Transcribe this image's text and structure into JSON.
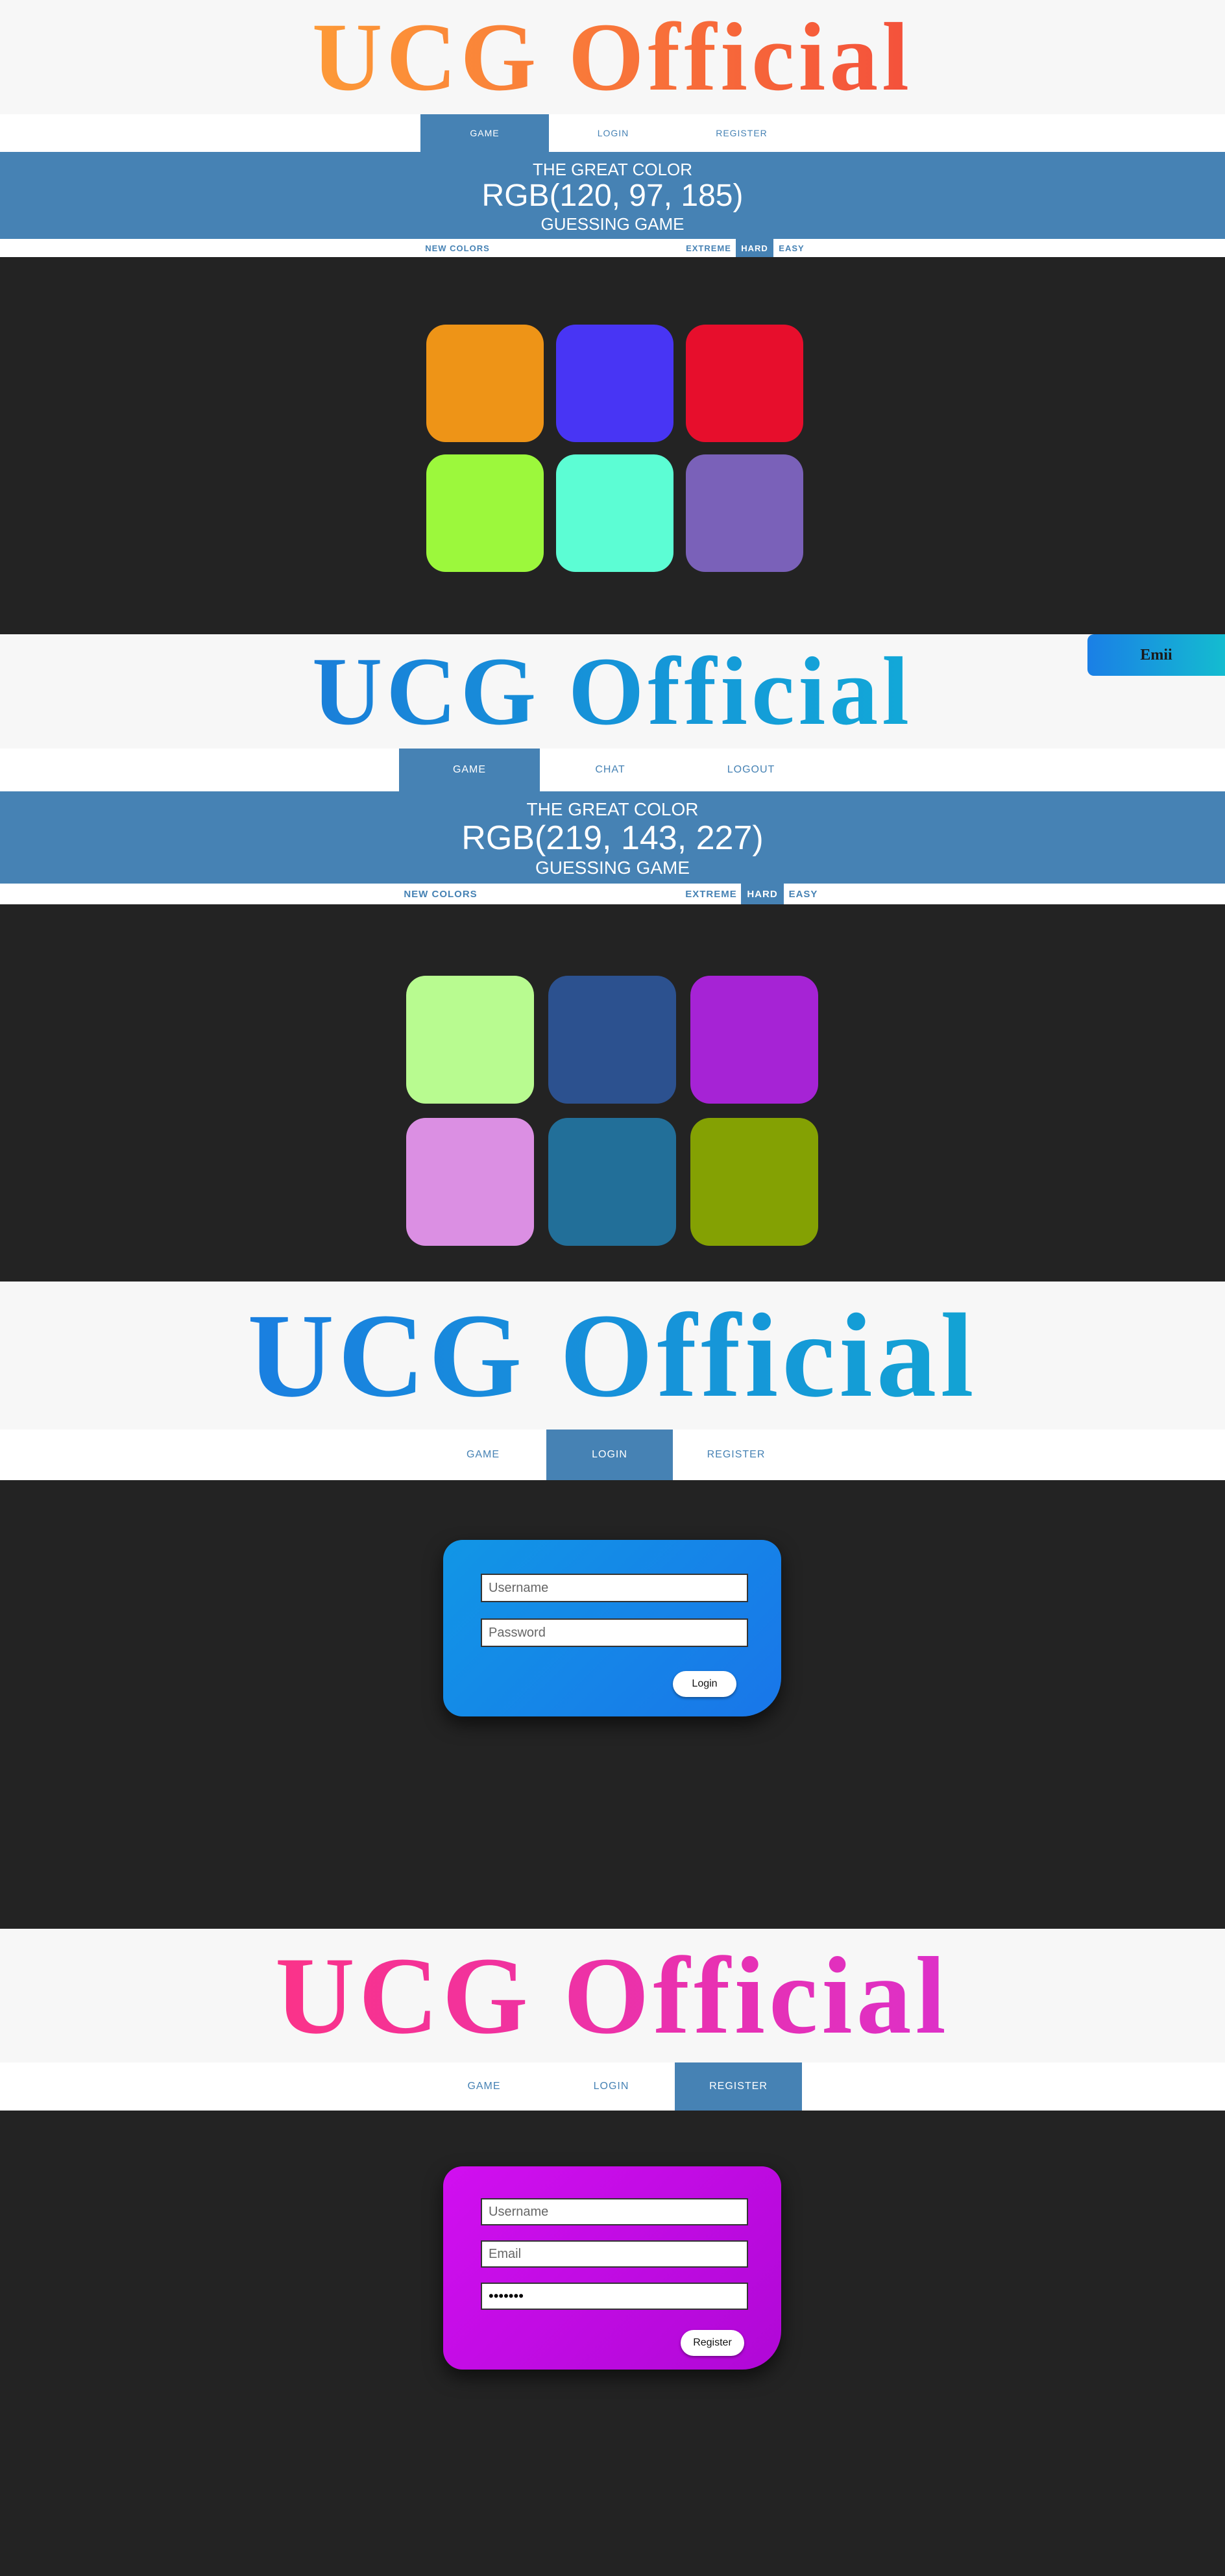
{
  "logo_text": "UCG Official",
  "screens": {
    "game_guest": {
      "nav": [
        "GAME",
        "LOGIN",
        "REGISTER"
      ],
      "banner": {
        "line1": "THE GREAT COLOR",
        "rgb": "RGB(120, 97, 185)",
        "line3": "GUESSING GAME"
      },
      "toolbar": {
        "new_colors": "NEW COLORS",
        "extreme": "EXTREME",
        "hard": "HARD",
        "easy": "EASY",
        "selected": "HARD"
      },
      "squares": [
        "#ee9417",
        "#4835f4",
        "#e70e2c",
        "#9cf83c",
        "#5cfdd4",
        "#7a61b9"
      ],
      "logo_gradient": [
        "#fd9a38",
        "#f4513b"
      ]
    },
    "game_user": {
      "user_button": "Emii",
      "nav": [
        "GAME",
        "CHAT",
        "LOGOUT"
      ],
      "banner": {
        "line1": "THE GREAT COLOR",
        "rgb": "RGB(219, 143, 227)",
        "line3": "GUESSING GAME"
      },
      "toolbar": {
        "new_colors": "NEW COLORS",
        "extreme": "EXTREME",
        "hard": "HARD",
        "easy": "EASY",
        "selected": "HARD"
      },
      "squares": [
        "#b8fb90",
        "#2c518f",
        "#a623d5",
        "#db8fe3",
        "#226f99",
        "#84a103"
      ],
      "logo_gradient": [
        "#1a7fd9",
        "#12a8d8"
      ]
    },
    "login": {
      "nav": [
        "GAME",
        "LOGIN",
        "REGISTER"
      ],
      "username_placeholder": "Username",
      "password_placeholder": "Password",
      "button": "Login",
      "logo_gradient": [
        "#1a7fe0",
        "#13a3d4"
      ],
      "card_gradient": [
        "#1196e6",
        "#1976e9"
      ]
    },
    "register": {
      "nav": [
        "GAME",
        "LOGIN",
        "REGISTER"
      ],
      "username_placeholder": "Username",
      "email_placeholder": "Email",
      "password_value": "•••••••",
      "button": "Register",
      "logo_gradient": [
        "#fb3389",
        "#dd30c8"
      ],
      "card_gradient": [
        "#d10ff0",
        "#b008d6"
      ]
    }
  }
}
